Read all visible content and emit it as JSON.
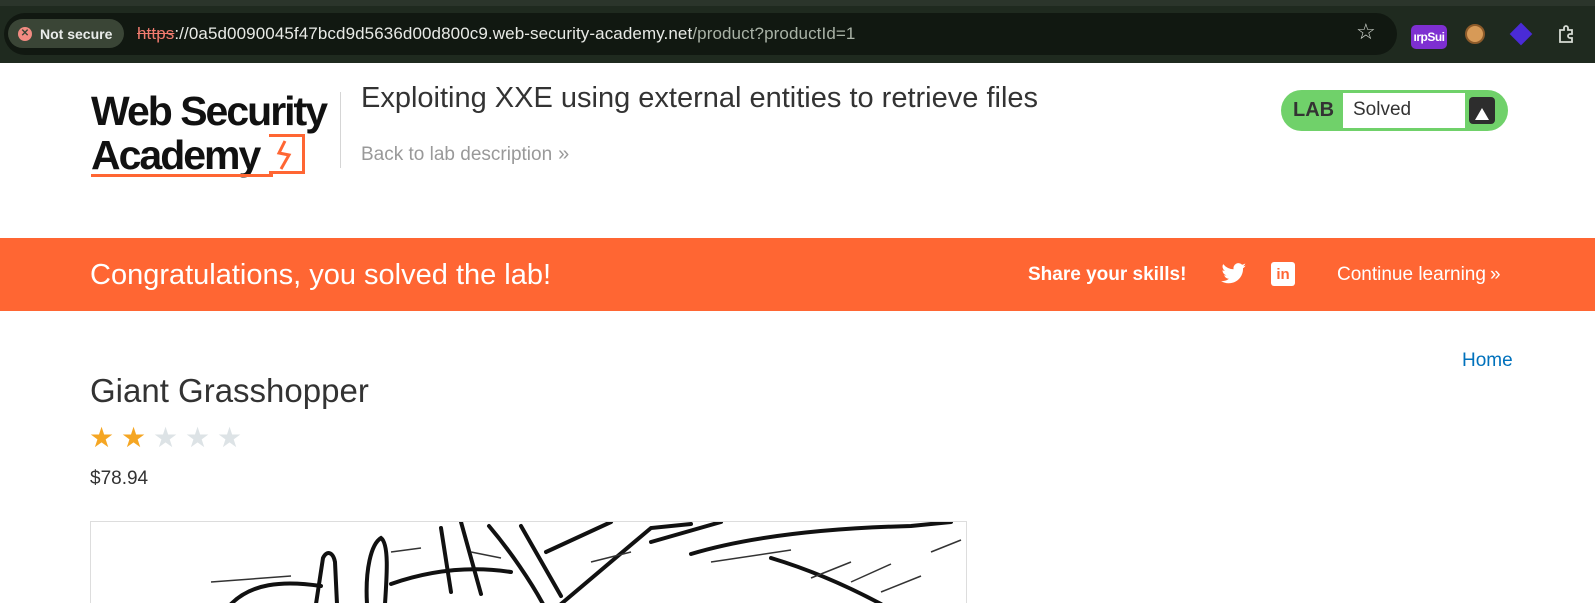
{
  "browser": {
    "security_label": "Not secure",
    "url_scheme": "https",
    "url_host": "://0a5d0090045f47bcd9d5636d00d800c9.web-security-academy.net",
    "url_path": "/product?productId=1",
    "extension_burp_label": "ırpSui",
    "icons": [
      "info-x-icon",
      "bookmark-star-icon",
      "burp-extension-icon",
      "cookie-extension-icon",
      "diamond-extension-icon",
      "puzzle-extensions-icon"
    ]
  },
  "header": {
    "logo_line1": "Web Security",
    "logo_line2": "Academy",
    "lab_title": "Exploiting XXE using external entities to retrieve files",
    "back_link": "Back to lab description",
    "lab_badge_label": "LAB",
    "lab_status": "Solved"
  },
  "banner": {
    "message": "Congratulations, you solved the lab!",
    "share_label": "Share your skills!",
    "continue_label": "Continue learning",
    "icons": [
      "twitter-icon",
      "linkedin-icon",
      "chevron-right-icon"
    ]
  },
  "nav": {
    "home": "Home"
  },
  "product": {
    "name": "Giant Grasshopper",
    "rating": 2,
    "rating_max": 5,
    "price": "$78.94"
  },
  "colors": {
    "accent": "#ff6633",
    "solved_green": "#70d16a",
    "star_filled": "#f5a623",
    "star_empty": "#dde3e6",
    "link": "#0071bc"
  }
}
